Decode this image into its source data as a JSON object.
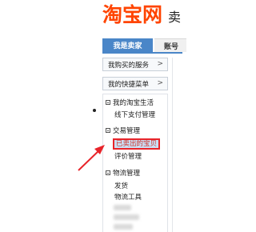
{
  "header": {
    "logo_text": "淘宝网",
    "logo_tail": "卖"
  },
  "tabs": [
    {
      "label": "我是卖家",
      "active": true
    },
    {
      "label": "账号"
    }
  ],
  "nav_buttons": [
    {
      "label": "我购买的服务",
      "chevron": ">"
    },
    {
      "label": "我的快捷菜单",
      "chevron": ">"
    }
  ],
  "menu": {
    "sections": [
      {
        "title": "我的淘宝生活",
        "items": [
          "线下支付管理"
        ]
      },
      {
        "title": "交易管理",
        "items": [
          "已卖出的宝贝",
          "评价管理"
        ],
        "highlighted_item": "已卖出的宝贝"
      },
      {
        "title": "物流管理",
        "items": [
          "发货",
          "物流工具"
        ]
      }
    ]
  },
  "colors": {
    "brand": "#ff4400",
    "tab_active": "#4a86c8",
    "highlight_border": "#e8242a",
    "arrow": "#e8242a"
  }
}
